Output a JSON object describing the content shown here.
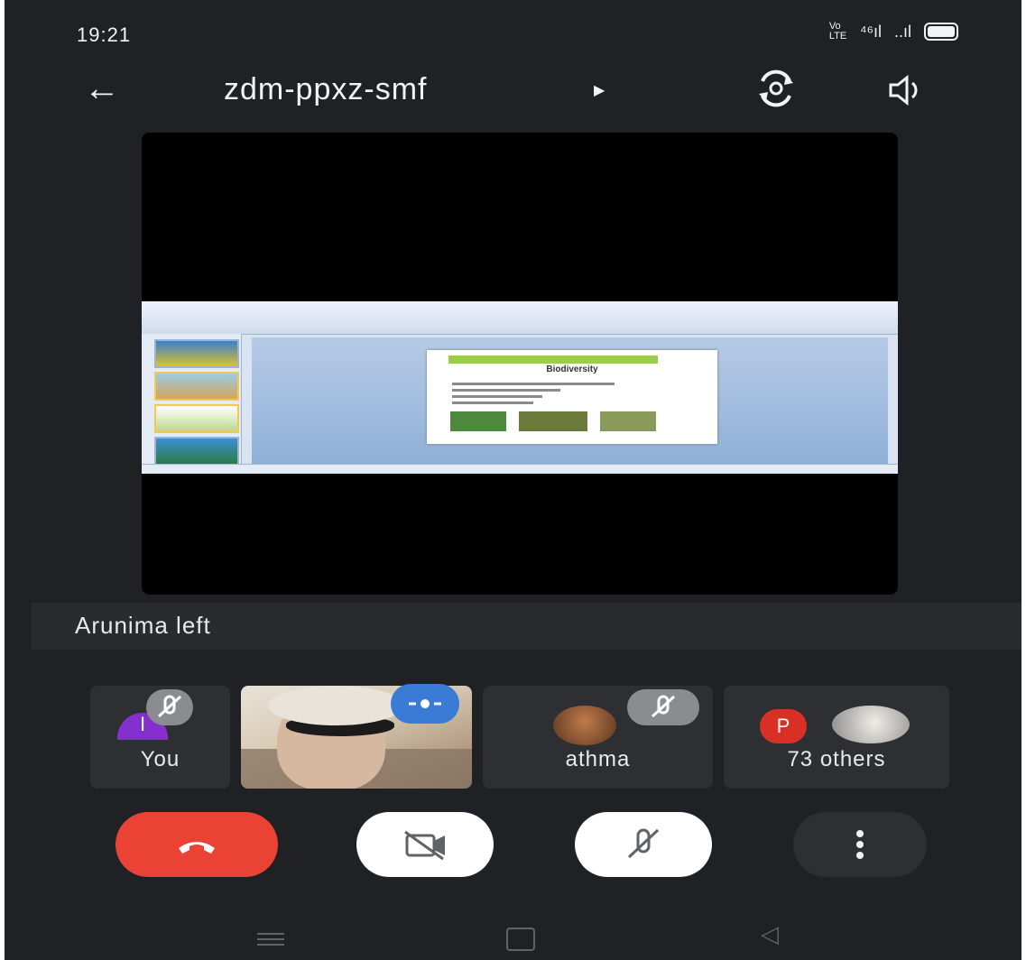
{
  "status_bar": {
    "time": "19:21",
    "network": "Vo LTE",
    "signal_label": "⁴⁶ıl",
    "signal2_label": "..ıl"
  },
  "app_bar": {
    "meeting_code": "zdm-ppxz-smf",
    "icons": [
      "back-arrow-icon",
      "switch-camera-icon",
      "speaker-icon"
    ]
  },
  "presentation": {
    "slide_title": "Biodiversity"
  },
  "toast": {
    "message": "Arunima left"
  },
  "participants": [
    {
      "label": "You",
      "avatar_initial": "I",
      "avatar_color": "#8430ce",
      "muted": true
    },
    {
      "label": "",
      "type": "video",
      "speaking": true
    },
    {
      "label": "athma",
      "muted": true
    },
    {
      "label": "73 others",
      "avatar_initial": "P",
      "avatar_color": "#d93025"
    }
  ],
  "controls": {
    "end_call_color": "#ea4335",
    "icons": [
      "end-call-icon",
      "camera-off-icon",
      "mic-off-icon",
      "more-options-icon"
    ]
  },
  "colors": {
    "background": "#202124",
    "tile": "#2e2f32",
    "accent_blue": "#3a7bd5"
  }
}
